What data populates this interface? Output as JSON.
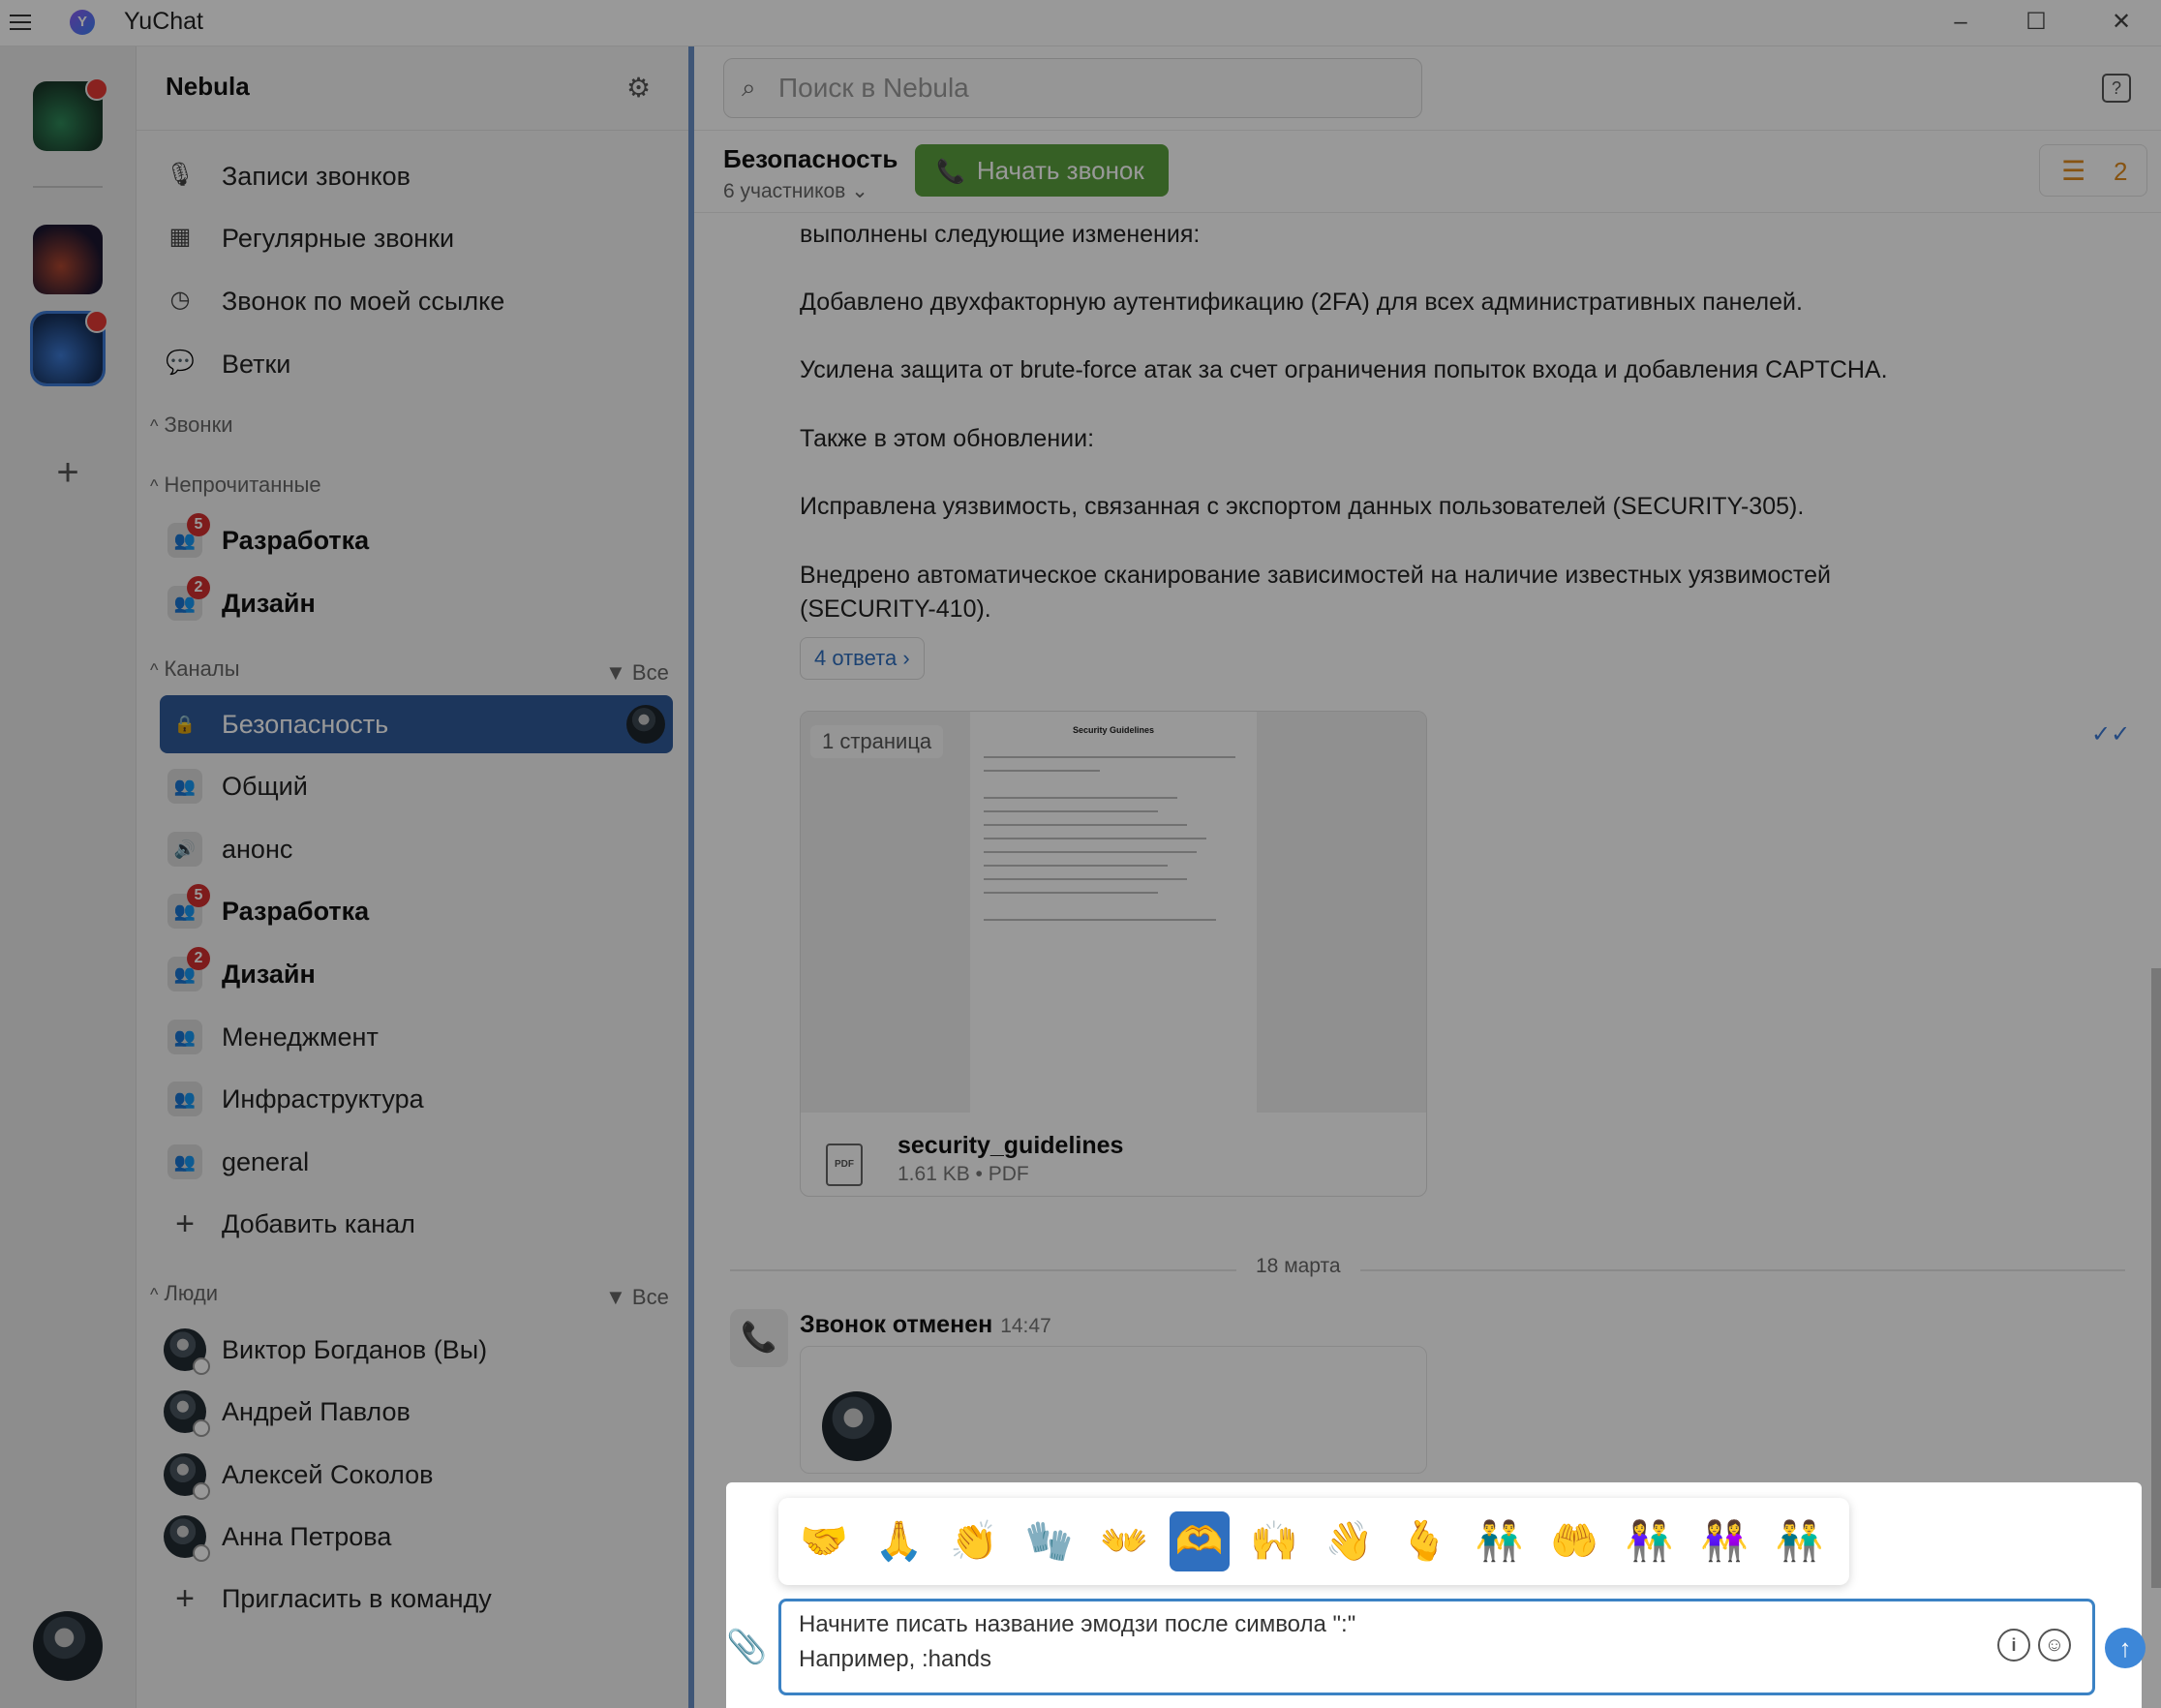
{
  "window": {
    "title": "YuChat"
  },
  "servers": [
    {
      "name": "aurora",
      "colors": [
        "#1a3a2a",
        "#2f8a5a"
      ],
      "unread": true
    },
    {
      "name": "galaxy",
      "colors": [
        "#1c1630",
        "#b0472f"
      ],
      "unread": false
    },
    {
      "name": "nebula",
      "colors": [
        "#16305a",
        "#3d7bd6"
      ],
      "unread": true,
      "active": true
    }
  ],
  "sidebar": {
    "workspace": "Nebula",
    "nav": [
      {
        "label": "Записи звонков",
        "icon": "mic-icon"
      },
      {
        "label": "Регулярные звонки",
        "icon": "calendar-icon"
      },
      {
        "label": "Звонок по моей ссылке",
        "icon": "clock-icon"
      },
      {
        "label": "Ветки",
        "icon": "thread-icon"
      }
    ],
    "sections": {
      "calls": "Звонки",
      "unread": "Непрочитанные",
      "channels": "Каналы",
      "people": "Люди",
      "filter_all": "Все"
    },
    "unread_items": [
      {
        "name": "Разработка",
        "badge": "5"
      },
      {
        "name": "Дизайн",
        "badge": "2"
      }
    ],
    "channels": [
      {
        "name": "Безопасность",
        "icon": "lock-icon",
        "active": true
      },
      {
        "name": "Общий",
        "icon": "group-icon"
      },
      {
        "name": "анонс",
        "icon": "speaker-icon"
      },
      {
        "name": "Разработка",
        "icon": "group-icon",
        "badge": "5"
      },
      {
        "name": "Дизайн",
        "icon": "group-icon",
        "badge": "2"
      },
      {
        "name": "Менеджмент",
        "icon": "group-icon"
      },
      {
        "name": "Инфраструктура",
        "icon": "group-icon"
      },
      {
        "name": "general",
        "icon": "group-icon"
      }
    ],
    "add_channel": "Добавить канал",
    "people": [
      {
        "name": "Виктор Богданов (Вы)"
      },
      {
        "name": "Андрей Павлов"
      },
      {
        "name": "Алексей Соколов"
      },
      {
        "name": "Анна Петрова"
      }
    ],
    "invite": "Пригласить в команду"
  },
  "main": {
    "search_placeholder": "Поиск в Nebula",
    "channel_title": "Безопасность",
    "members": "6 участников",
    "call_button": "Начать звонок",
    "pinned_count": "2",
    "message_lines": [
      "выполнены следующие изменения:",
      "Добавлено двухфакторную аутентификацию (2FA) для всех административных панелей.",
      "Усилена защита от brute-force атак за счет ограничения попыток входа и добавления CAPTCHA.",
      "Также в этом обновлении:",
      "Исправлена уязвимость, связанная с экспортом данных пользователей (SECURITY-305).",
      "Внедрено автоматическое сканирование зависимостей на наличие известных уязвимостей",
      "(SECURITY-410)."
    ],
    "replies": "4 ответа",
    "attachment": {
      "page_tag": "1 страница",
      "doc_title": "Security Guidelines",
      "file_name": "security_guidelines",
      "file_meta": "1.61 KB • PDF"
    },
    "date_separator": "18 марта",
    "call_event": {
      "title": "Звонок отменен",
      "time": "14:47"
    }
  },
  "composer": {
    "emojis": [
      "🤝",
      "🙏",
      "👏",
      "🧤",
      "👐",
      "🫶",
      "🙌",
      "👋",
      "🫰",
      "👬",
      "🤲",
      "👫",
      "👭",
      "👬"
    ],
    "selected_index": 5,
    "hint_line1": "Начните писать название эмодзи после символа \":\"",
    "hint_line2": "Например, :hands"
  }
}
